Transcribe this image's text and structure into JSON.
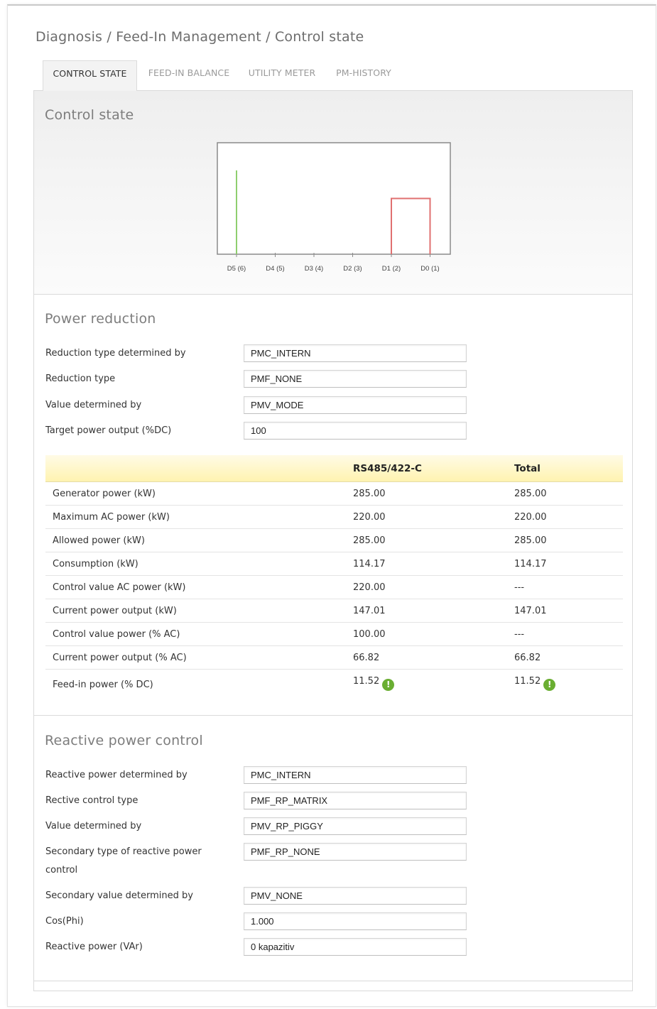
{
  "breadcrumb": "Diagnosis / Feed-In Management / Control state",
  "tabs": [
    {
      "label": "CONTROL STATE",
      "active": true
    },
    {
      "label": "FEED-IN BALANCE",
      "active": false
    },
    {
      "label": "UTILITY METER",
      "active": false
    },
    {
      "label": "PM-HISTORY",
      "active": false
    }
  ],
  "control_state": {
    "title": "Control state",
    "chart_data": {
      "type": "bar",
      "categories": [
        "D5 (6)",
        "D4 (5)",
        "D3 (4)",
        "D2 (3)",
        "D1 (2)",
        "D0 (1)"
      ],
      "series": [
        {
          "color": "#8fce6f",
          "marker_at": "D5 (6)"
        },
        {
          "color": "#e07070",
          "range": [
            "D1 (2)",
            "D0 (1)"
          ],
          "level": 0.5
        }
      ]
    }
  },
  "power_reduction": {
    "title": "Power reduction",
    "fields": [
      {
        "label": "Reduction type determined by",
        "value": "PMC_INTERN"
      },
      {
        "label": "Reduction type",
        "value": "PMF_NONE"
      },
      {
        "label": "Value determined by",
        "value": "PMV_MODE"
      },
      {
        "label": "Target power output (%DC)",
        "value": "100"
      }
    ],
    "table": {
      "headers": [
        "",
        "RS485/422-C",
        "Total"
      ],
      "rows": [
        [
          "Generator power (kW)",
          "285.00",
          "285.00"
        ],
        [
          "Maximum AC power (kW)",
          "220.00",
          "220.00"
        ],
        [
          "Allowed power (kW)",
          "285.00",
          "285.00"
        ],
        [
          "Consumption (kW)",
          "114.17",
          "114.17"
        ],
        [
          "Control value AC power (kW)",
          "220.00",
          "---"
        ],
        [
          "Current power output (kW)",
          "147.01",
          "147.01"
        ],
        [
          "Control value power (% AC)",
          "100.00",
          "---"
        ],
        [
          "Current power output (% AC)",
          "66.82",
          "66.82"
        ],
        [
          "Feed-in power (% DC)",
          "11.52",
          "11.52"
        ]
      ],
      "warn_icon_glyph": "!",
      "warn_icon_color": "#6aae32"
    }
  },
  "reactive_power": {
    "title": "Reactive power control",
    "fields": [
      {
        "label": "Reactive power determined by",
        "value": "PMC_INTERN"
      },
      {
        "label": "Rective control type",
        "value": "PMF_RP_MATRIX"
      },
      {
        "label": "Value determined by",
        "value": "PMV_RP_PIGGY"
      },
      {
        "label": "Secondary type of reactive power control",
        "value": "PMF_RP_NONE"
      },
      {
        "label": "Secondary value determined by",
        "value": "PMV_NONE"
      },
      {
        "label": "Cos(Phi)",
        "value": "1.000"
      },
      {
        "label": "Reactive power (VAr)",
        "value": "0 kapazitiv"
      }
    ]
  }
}
